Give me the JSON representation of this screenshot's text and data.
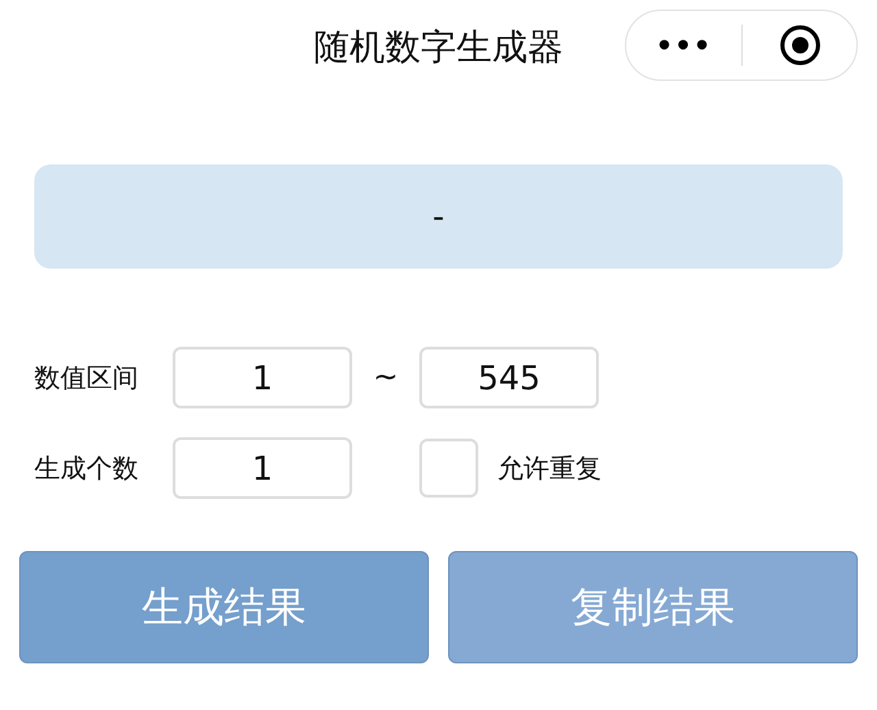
{
  "nav_bar": {
    "title": "随机数字生成器",
    "menu_icon": "•••"
  },
  "result": {
    "value": "-"
  },
  "range": {
    "label": "数值区间",
    "min": "1",
    "separator": "~",
    "max": "545"
  },
  "count": {
    "label": "生成个数",
    "value": "1"
  },
  "allow_repeat": {
    "label": "允许重复",
    "checked": false
  },
  "buttons": [
    {
      "label": "生成结果",
      "disabled": false
    },
    {
      "label": "复制结果",
      "disabled": true
    }
  ]
}
